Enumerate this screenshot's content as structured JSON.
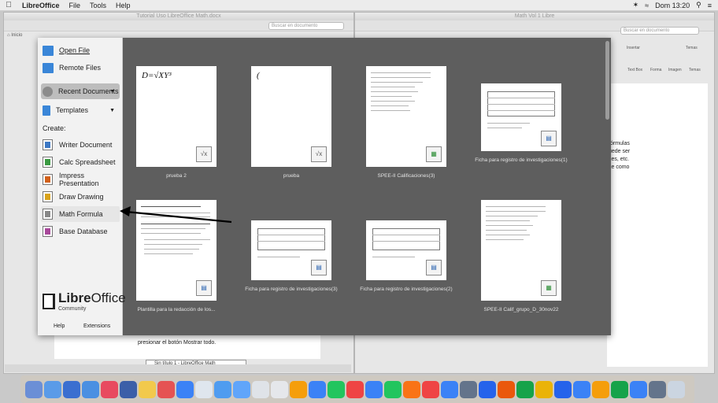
{
  "menubar": {
    "app_name": "LibreOffice",
    "items": [
      "File",
      "Tools",
      "Help"
    ],
    "clock": "Dom 13:20"
  },
  "background_windows": {
    "left_title": "Tutorial Uso LibreOffice Math.docx",
    "right_title": "Math Vol 1 Libre",
    "search_placeholder": "Buscar en documento",
    "tab_label": "Inicio",
    "doc_text_left": "presionar el botón Mostrar todo.",
    "doc_window_caption": "Sin título 1 - LibreOffice Math",
    "right_doc_lines": [
      "fórmulas",
      "uede ser",
      "ces, etc.",
      "ce como"
    ],
    "ribbon_labels": [
      "Insertar",
      "Temas",
      "Text Box",
      "Forma",
      "Imagen",
      "Temas"
    ]
  },
  "sidebar": {
    "open_file": "Open File",
    "remote_files": "Remote Files",
    "recent_documents": "Recent Documents",
    "templates": "Templates",
    "create_label": "Create:",
    "modules": [
      {
        "label": "Writer Document",
        "icon": "writer-icon"
      },
      {
        "label": "Calc Spreadsheet",
        "icon": "calc-icon"
      },
      {
        "label": "Impress Presentation",
        "icon": "impress-icon"
      },
      {
        "label": "Draw Drawing",
        "icon": "draw-icon"
      },
      {
        "label": "Math Formula",
        "icon": "math-icon"
      },
      {
        "label": "Base Database",
        "icon": "base-icon"
      }
    ],
    "logo": {
      "name_light": "Libre",
      "name_bold": "Office",
      "sub": "Community"
    },
    "help": "Help",
    "extensions": "Extensions"
  },
  "recent_files": [
    {
      "caption": "prueba 2",
      "kind": "math",
      "formula": "D=√XY³"
    },
    {
      "caption": "prueba",
      "kind": "math",
      "formula": "("
    },
    {
      "caption": "SPEE-II Calificaciones(3)",
      "kind": "calc"
    },
    {
      "caption": "Ficha para registro de investigaciones(1)",
      "kind": "writer"
    },
    {
      "caption": "Plantilla para la redacción de los...",
      "kind": "writer"
    },
    {
      "caption": "Ficha para registro de investigaciones(3)",
      "kind": "writer"
    },
    {
      "caption": "Ficha para registro de investigaciones(2)",
      "kind": "writer"
    },
    {
      "caption": "SPEE-II Calif_grupo_D_30nov22",
      "kind": "calc"
    }
  ],
  "colors": {
    "startcenter_bg": "#5e5e5e",
    "sidebar_bg": "#f2f2f2",
    "selected_item_bg": "#bdbdbd",
    "annotation_arrow": "#000000"
  }
}
